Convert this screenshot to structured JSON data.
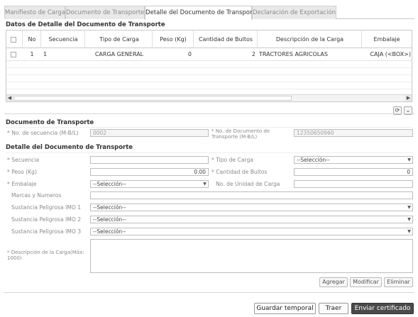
{
  "tabs": [
    "Manifiesto de Carga",
    "Documento de Transporte",
    "Detalle del Documento de Transporte",
    "Declaración de Exportación"
  ],
  "grid_title": "Datos de Detalle del Documento de Transporte",
  "grid": {
    "headers": [
      "No",
      "Secuencia",
      "Tipo de Carga",
      "Peso (Kg)",
      "Cantidad de Bultos",
      "Descripción de la Carga",
      "Embalaje"
    ],
    "rows": [
      {
        "no": "1",
        "secuencia": "1",
        "tipo": "CARGA GENERAL",
        "peso": "0",
        "bultos": "2",
        "descripcion": "TRACTORES AGRICOLAS",
        "embalaje": "CAJA (<BOX>)"
      }
    ]
  },
  "doc_section": {
    "title": "Documento de Transporte",
    "seq_label": "No. de secuencia (M-B/L)",
    "seq_value": "0002",
    "docno_label": "No. de Documento de Transporte (M-B/L)",
    "docno_value": "12350650960"
  },
  "detail_section": {
    "title": "Detalle del Documento de Transporte",
    "secuencia_label": "Secuencia",
    "tipo_label": "Tipo de Carga",
    "tipo_value": "--Selección--",
    "peso_label": "Peso (Kg)",
    "peso_value": "0.00",
    "bultos_label": "Cantidad de Bultos",
    "bultos_value": "0",
    "embalaje_label": "Embalaje",
    "embalaje_value": "--Selección--",
    "unidad_label": "No. de Unidad de Carga",
    "marcas_label": "Marcas y Numeros",
    "imo1_label": "Sustancia Peligrosa IMO 1",
    "imo1_value": "--Selección--",
    "imo2_label": "Sustancia Peligrosa IMO 2",
    "imo2_value": "--Selección--",
    "imo3_label": "Sustancia Peligrosa IMO 3",
    "imo3_value": "--Selección--",
    "desc_label": "Descripción de la Carga(Máx: 1000)"
  },
  "buttons": {
    "agregar": "Agregar",
    "modificar": "Modificar",
    "eliminar": "Eliminar"
  },
  "footer_buttons": {
    "guardar": "Guardar temporal",
    "traer": "Traer",
    "enviar": "Enviar certificado"
  },
  "required_marker": "*"
}
